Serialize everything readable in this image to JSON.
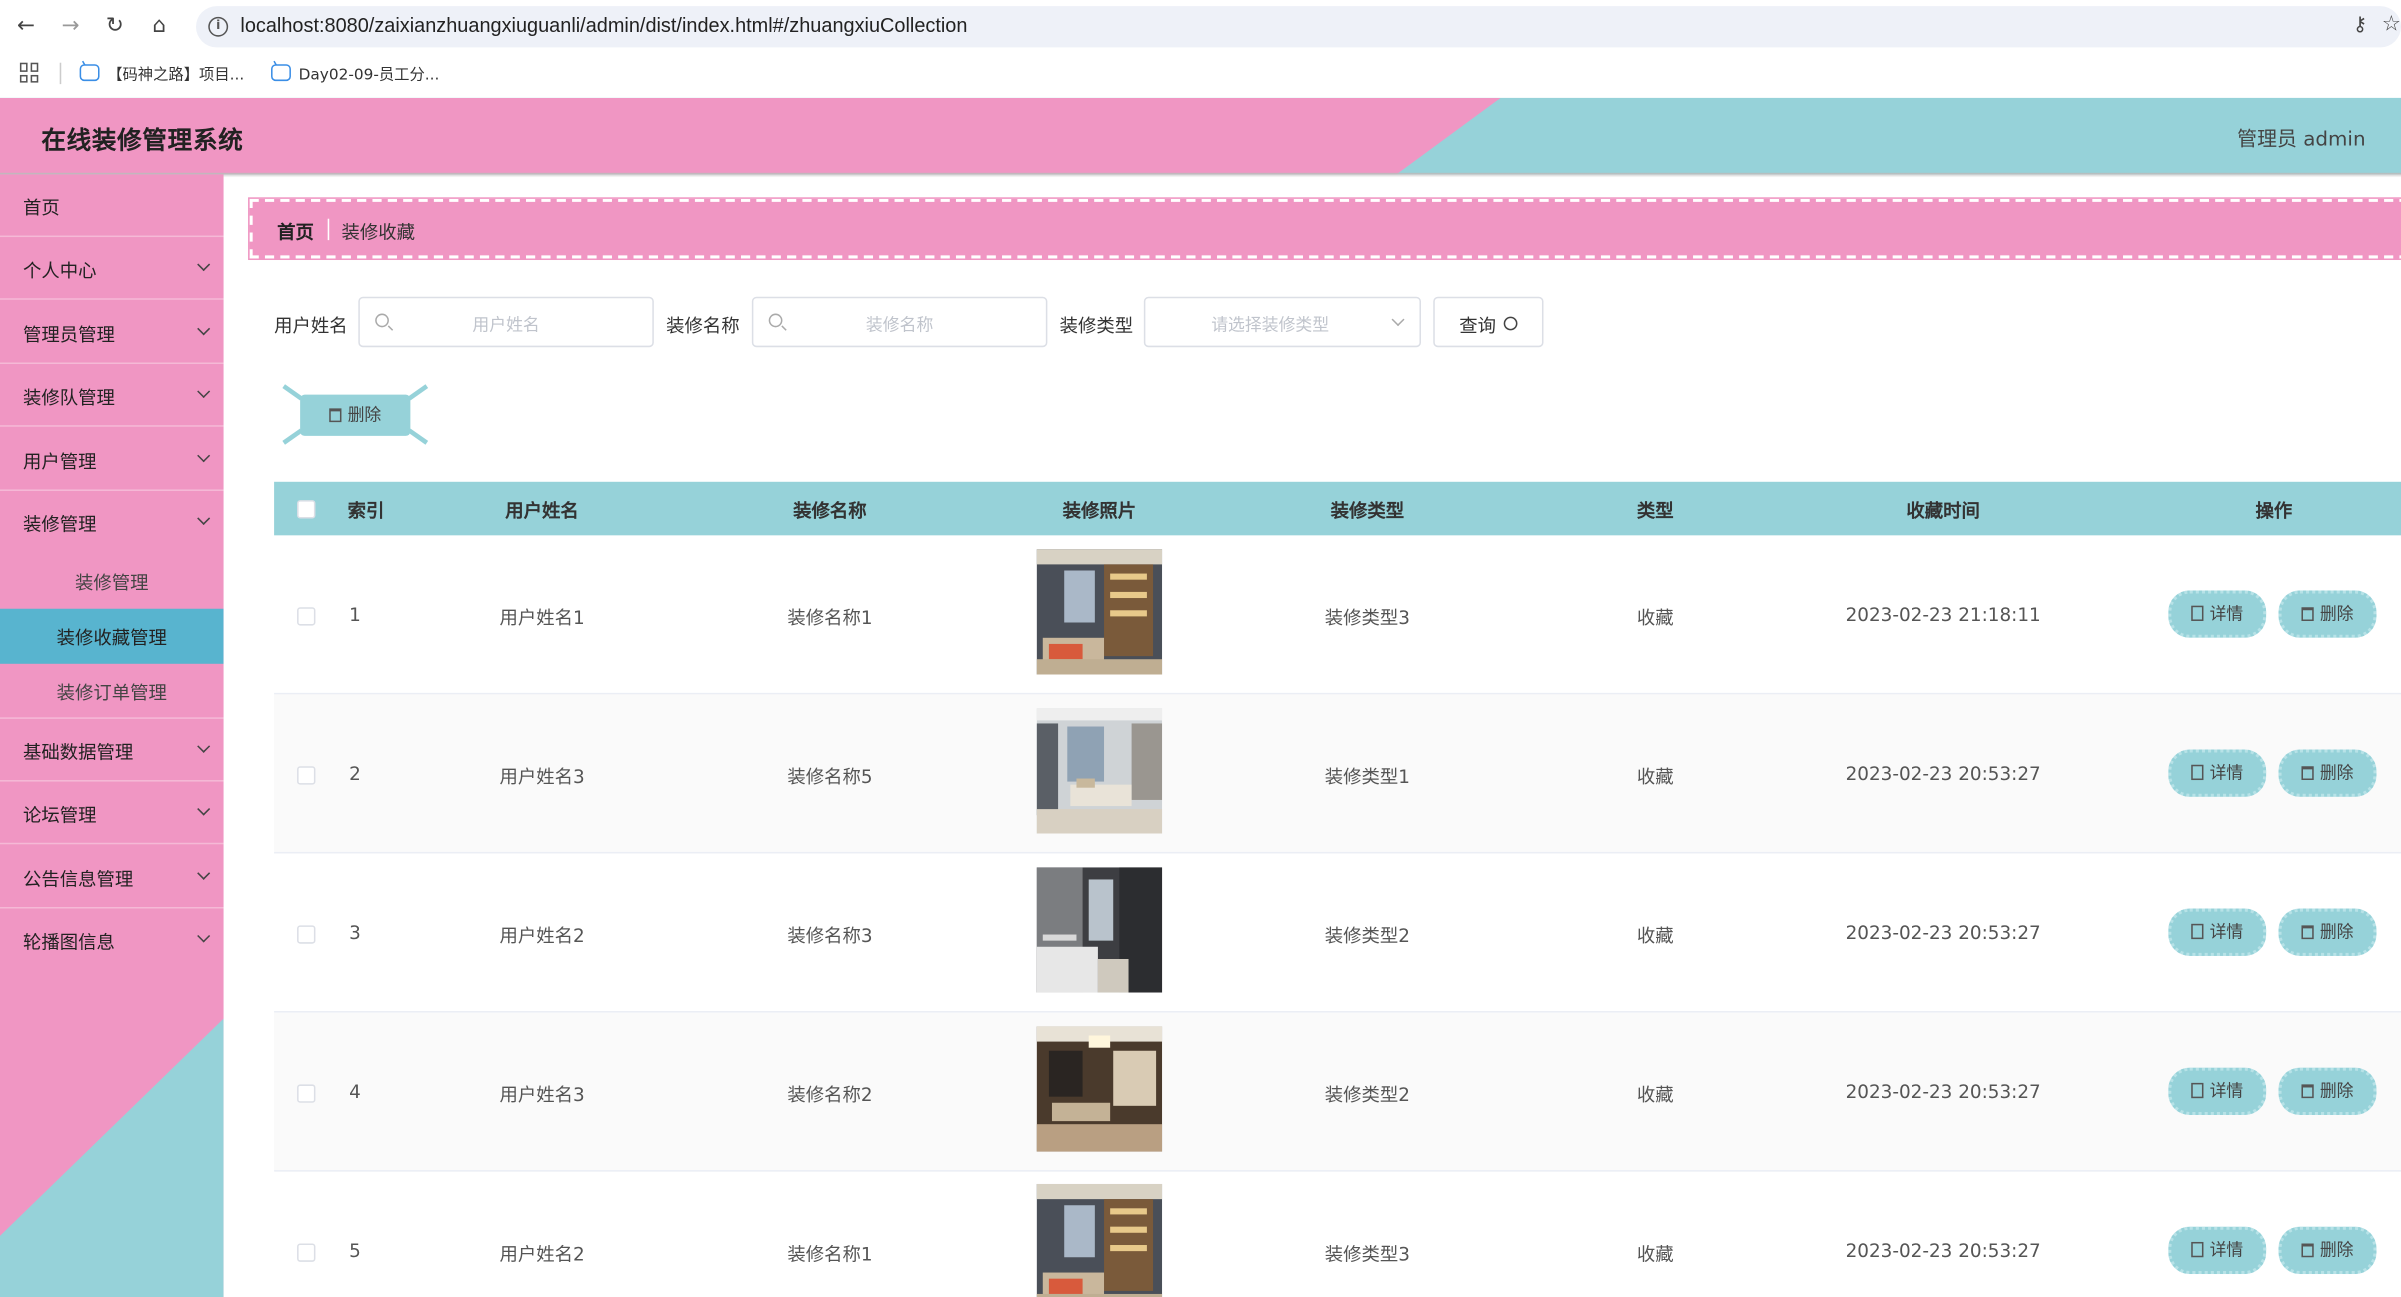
{
  "browser": {
    "url": "localhost:8080/zaixianzhuangxiuguanli/admin/dist/index.html#/zhuangxiuCollection",
    "bookmarks": [
      "【码神之路】项目...",
      "Day02-09-员工分..."
    ]
  },
  "header": {
    "title": "在线装修管理系统",
    "admin": "管理员 admin",
    "colors": {
      "pink": "#f096c3",
      "teal": "#96d2d9",
      "active": "#58b4cf"
    }
  },
  "sidebar": {
    "items": [
      {
        "label": "首页",
        "expandable": false
      },
      {
        "label": "个人中心",
        "expandable": true
      },
      {
        "label": "管理员管理",
        "expandable": true
      },
      {
        "label": "装修队管理",
        "expandable": true
      },
      {
        "label": "用户管理",
        "expandable": true
      },
      {
        "label": "装修管理",
        "expandable": true
      },
      {
        "label": "基础数据管理",
        "expandable": true
      },
      {
        "label": "论坛管理",
        "expandable": true
      },
      {
        "label": "公告信息管理",
        "expandable": true
      },
      {
        "label": "轮播图信息",
        "expandable": true
      }
    ],
    "submenu": [
      {
        "label": "装修管理",
        "active": false
      },
      {
        "label": "装修收藏管理",
        "active": true
      },
      {
        "label": "装修订单管理",
        "active": false
      }
    ]
  },
  "breadcrumb": {
    "home": "首页",
    "current": "装修收藏"
  },
  "search": {
    "user_label": "用户姓名",
    "user_placeholder": "用户姓名",
    "name_label": "装修名称",
    "name_placeholder": "装修名称",
    "type_label": "装修类型",
    "type_placeholder": "请选择装修类型",
    "query_button": "查询"
  },
  "bulk_delete": "删除",
  "table": {
    "columns": [
      "索引",
      "用户姓名",
      "装修名称",
      "装修照片",
      "装修类型",
      "类型",
      "收藏时间",
      "操作"
    ],
    "rows": [
      {
        "index": "1",
        "user": "用户姓名1",
        "name": "装修名称1",
        "photo": "interior-photo-1",
        "deco_type": "装修类型3",
        "type": "收藏",
        "time": "2023-02-23 21:18:11"
      },
      {
        "index": "2",
        "user": "用户姓名3",
        "name": "装修名称5",
        "photo": "interior-photo-2",
        "deco_type": "装修类型1",
        "type": "收藏",
        "time": "2023-02-23 20:53:27"
      },
      {
        "index": "3",
        "user": "用户姓名2",
        "name": "装修名称3",
        "photo": "interior-photo-3",
        "deco_type": "装修类型2",
        "type": "收藏",
        "time": "2023-02-23 20:53:27"
      },
      {
        "index": "4",
        "user": "用户姓名3",
        "name": "装修名称2",
        "photo": "interior-photo-4",
        "deco_type": "装修类型2",
        "type": "收藏",
        "time": "2023-02-23 20:53:27"
      },
      {
        "index": "5",
        "user": "用户姓名2",
        "name": "装修名称1",
        "photo": "interior-photo-1",
        "deco_type": "装修类型3",
        "type": "收藏",
        "time": "2023-02-23 20:53:27"
      }
    ],
    "detail_button": "详情",
    "delete_button": "删除"
  }
}
